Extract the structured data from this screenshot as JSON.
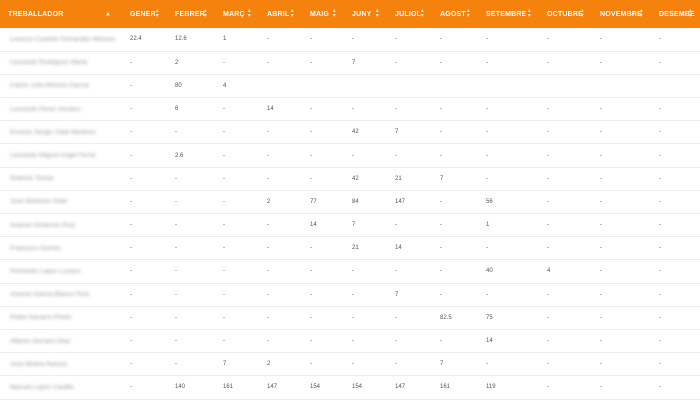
{
  "table": {
    "columns": [
      "TREBALLADOR",
      "GENER",
      "FEBRER",
      "MARÇ",
      "ABRIL",
      "MAIG",
      "JUNY",
      "JULIOL",
      "AGOST",
      "SETEMBRE",
      "OCTUBRE",
      "NOVEMBRE",
      "DESEMBE"
    ],
    "rows": [
      {
        "name": "Lorenzo Castells Fernandez Moreno",
        "values": [
          "22.4",
          "12.6",
          "1",
          "-",
          "-",
          "-",
          "-",
          "-",
          "-",
          "-",
          "-",
          "-"
        ]
      },
      {
        "name": "Leonardo Rodriguez Maria",
        "values": [
          "-",
          "2",
          "-",
          "-",
          "-",
          "7",
          "-",
          "-",
          "-",
          "-",
          "-",
          "-"
        ]
      },
      {
        "name": "Carlos Julia Moreno Garcia",
        "values": [
          "-",
          "80",
          "4",
          "",
          "",
          "",
          "",
          "",
          "",
          "",
          "",
          ""
        ]
      },
      {
        "name": "Leonardo Perez Soriano",
        "values": [
          "-",
          "6",
          "-",
          "14",
          "-",
          "-",
          "-",
          "-",
          "-",
          "-",
          "-",
          "-"
        ]
      },
      {
        "name": "Ernesto Sergio Vidal Martinez",
        "values": [
          "-",
          "-",
          "-",
          "-",
          "-",
          "42",
          "7",
          "-",
          "-",
          "-",
          "-",
          "-"
        ]
      },
      {
        "name": "Leonardo Miguel Angel Ferrer",
        "values": [
          "-",
          "2.6",
          "-",
          "-",
          "-",
          "-",
          "-",
          "-",
          "-",
          "-",
          "-",
          "-"
        ]
      },
      {
        "name": "Roberto Tomas",
        "values": [
          "-",
          "-",
          "-",
          "-",
          "-",
          "42",
          "21",
          "7",
          "-",
          "-",
          "-",
          "-"
        ]
      },
      {
        "name": "Joan Martinez Soler",
        "values": [
          "-",
          "-",
          "-",
          "2",
          "77",
          "84",
          "147",
          "-",
          "56",
          "-",
          "-",
          "-"
        ]
      },
      {
        "name": "Antonio Gutierrez Ruiz",
        "values": [
          "-",
          "-",
          "-",
          "-",
          "14",
          "7",
          "-",
          "-",
          "1",
          "-",
          "-",
          "-"
        ]
      },
      {
        "name": "Francisco Gomez",
        "values": [
          "-",
          "-",
          "-",
          "-",
          "-",
          "21",
          "14",
          "-",
          "-",
          "-",
          "-",
          "-"
        ]
      },
      {
        "name": "Fernando Lopez Lozano",
        "values": [
          "-",
          "-",
          "-",
          "-",
          "-",
          "-",
          "-",
          "-",
          "40",
          "4",
          "-",
          "-"
        ]
      },
      {
        "name": "Antonio Garcia Blanco Ruiz",
        "values": [
          "-",
          "-",
          "-",
          "-",
          "-",
          "-",
          "7",
          "-",
          "-",
          "-",
          "-",
          "-"
        ]
      },
      {
        "name": "Pedro Navarro Prieto",
        "values": [
          "-",
          "-",
          "-",
          "-",
          "-",
          "-",
          "-",
          "82.5",
          "75",
          "-",
          "-",
          "-"
        ]
      },
      {
        "name": "Alberto Serrano Diaz",
        "values": [
          "-",
          "-",
          "-",
          "-",
          "-",
          "-",
          "-",
          "-",
          "14",
          "-",
          "-",
          "-"
        ]
      },
      {
        "name": "Jose Molina Ramos",
        "values": [
          "-",
          "-",
          "7",
          "2",
          "-",
          "-",
          "-",
          "7",
          "-",
          "-",
          "-",
          "-"
        ]
      },
      {
        "name": "Manuel Lopez Castillo",
        "values": [
          "-",
          "140",
          "161",
          "147",
          "154",
          "154",
          "147",
          "161",
          "119",
          "-",
          "-",
          "-"
        ]
      }
    ]
  },
  "icons": {
    "sort_active": "sort-up-icon",
    "sort_inactive": "sort-both-icon"
  },
  "colors": {
    "header_bg": "#f5820d",
    "header_text": "#ffffff"
  }
}
